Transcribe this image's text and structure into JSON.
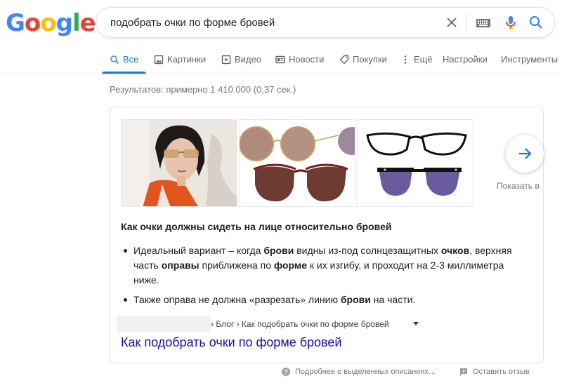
{
  "logo": {
    "text": "Google"
  },
  "search": {
    "query": "подобрать очки по форме бровей"
  },
  "tabs": [
    {
      "label": "Все",
      "icon": "search-icon",
      "active": true
    },
    {
      "label": "Картинки",
      "icon": "image-icon"
    },
    {
      "label": "Видео",
      "icon": "video-icon"
    },
    {
      "label": "Новости",
      "icon": "news-icon"
    },
    {
      "label": "Покупки",
      "icon": "tag-icon"
    },
    {
      "label": "Ещё",
      "icon": "more-vert-icon"
    },
    {
      "label": "Настройки"
    },
    {
      "label": "Инструменты"
    }
  ],
  "result_stats": "Результатов: примерно 1 410 000 (0,37 сек.)",
  "featured_snippet": {
    "show_more_label": "Показать в",
    "heading": "Как очки должны сидеть на лице относительно бровей",
    "bullet1": {
      "p1": "Идеальный вариант – когда ",
      "b1": "брови",
      "p2": " видны из-под солнцезащитных ",
      "b2": "очков",
      "p3": ", верхняя часть ",
      "b3": "оправы",
      "p4": " приближена по ",
      "b4": "форме",
      "p5": " к их изгибу, и проходит на 2-3 миллиметра ниже."
    },
    "bullet2": {
      "p1": "Также оправа не должна «разрезать» линию ",
      "b1": "брови",
      "p2": " на части."
    },
    "breadcrumb": "› Блог › Как подобрать очки по форме бровей",
    "link_title": "Как подобрать очки по форме бровей"
  },
  "footer": {
    "about_snippets": "Подробнее о выделенных описаниях…",
    "feedback": "Оставить отзыв"
  },
  "colors": {
    "accent": "#1a73e8",
    "link": "#1a0dab",
    "muted": "#70757a"
  }
}
